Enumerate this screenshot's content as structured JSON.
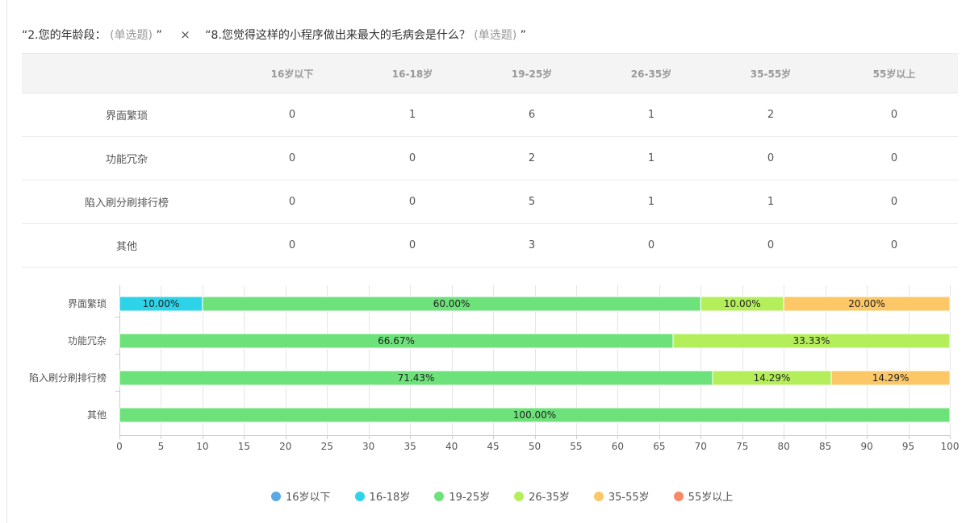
{
  "title": {
    "q1": "“2.您的年龄段：",
    "q1_type": "(单选题)",
    "q1_close": "”",
    "cross": "×",
    "q2": "“8.您觉得这样的小程序做出来最大的毛病会是什么？",
    "q2_type": "(单选题)",
    "q2_close": "”"
  },
  "table": {
    "columns": [
      "",
      "16岁以下",
      "16-18岁",
      "19-25岁",
      "26-35岁",
      "35-55岁",
      "55岁以上"
    ],
    "rows": [
      {
        "label": "界面繁琐",
        "cells": [
          "0",
          "1",
          "6",
          "1",
          "2",
          "0"
        ]
      },
      {
        "label": "功能冗杂",
        "cells": [
          "0",
          "0",
          "2",
          "1",
          "0",
          "0"
        ]
      },
      {
        "label": "陷入刷分刷排行榜",
        "cells": [
          "0",
          "0",
          "5",
          "1",
          "1",
          "0"
        ]
      },
      {
        "label": "其他",
        "cells": [
          "0",
          "0",
          "3",
          "0",
          "0",
          "0"
        ]
      }
    ]
  },
  "chart_data": {
    "type": "bar",
    "orientation": "horizontal",
    "stacked": true,
    "percent": true,
    "categories": [
      "界面繁琐",
      "功能冗杂",
      "陷入刷分刷排行榜",
      "其他"
    ],
    "series": [
      {
        "name": "16岁以下",
        "color": "#5aa9e6",
        "values": [
          0,
          0,
          0,
          0
        ],
        "labels": [
          "",
          "",
          "",
          ""
        ]
      },
      {
        "name": "16-18岁",
        "color": "#2dd3e8",
        "values": [
          10,
          0,
          0,
          0
        ],
        "labels": [
          "10.00%",
          "",
          "",
          ""
        ]
      },
      {
        "name": "19-25岁",
        "color": "#6ee27a",
        "values": [
          60,
          66.67,
          71.43,
          100
        ],
        "labels": [
          "60.00%",
          "66.67%",
          "71.43%",
          "100.00%"
        ]
      },
      {
        "name": "26-35岁",
        "color": "#b4ef5b",
        "values": [
          10,
          33.33,
          14.29,
          0
        ],
        "labels": [
          "10.00%",
          "33.33%",
          "14.29%",
          ""
        ]
      },
      {
        "name": "35-55岁",
        "color": "#fcc766",
        "values": [
          20,
          0,
          14.29,
          0
        ],
        "labels": [
          "20.00%",
          "",
          "14.29%",
          ""
        ]
      },
      {
        "name": "55岁以上",
        "color": "#f58a68",
        "values": [
          0,
          0,
          0,
          0
        ],
        "labels": [
          "",
          "",
          "",
          ""
        ]
      }
    ],
    "xlim": [
      0,
      100
    ],
    "xticks": [
      "0",
      "5",
      "10",
      "15",
      "20",
      "25",
      "30",
      "35",
      "40",
      "45",
      "50",
      "55",
      "60",
      "65",
      "70",
      "75",
      "80",
      "85",
      "90",
      "95",
      "100"
    ],
    "grid": true,
    "legend_position": "bottom"
  }
}
